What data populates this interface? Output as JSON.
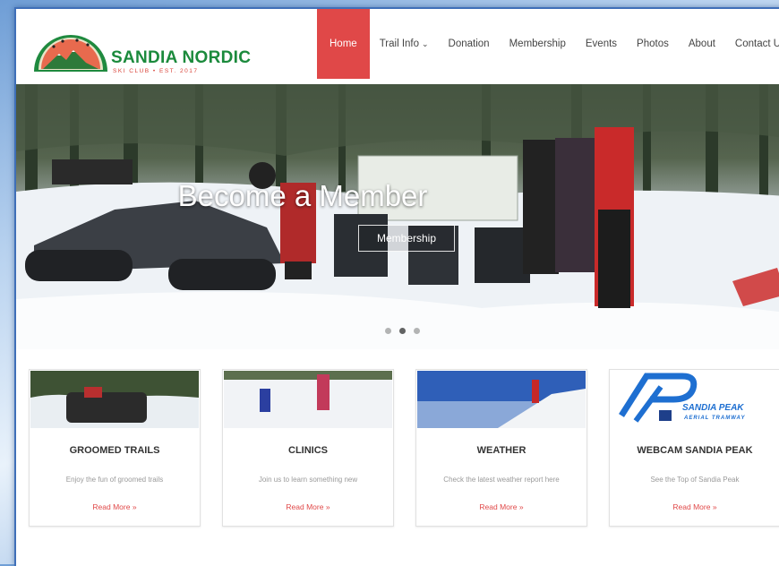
{
  "brand": {
    "name": "SANDIA NORDIC",
    "tagline": "SKI CLUB • EST. 2017"
  },
  "nav": {
    "items": [
      {
        "label": "Home",
        "active": true
      },
      {
        "label": "Trail Info"
      },
      {
        "label": "Donation"
      },
      {
        "label": "Membership"
      },
      {
        "label": "Events"
      },
      {
        "label": "Photos"
      },
      {
        "label": "About"
      },
      {
        "label": "Contact Us"
      }
    ],
    "dropdown_icon": "chevron-down-icon"
  },
  "hero": {
    "title": "Become a Member",
    "button_label": "Membership",
    "slides": 3,
    "active_slide": 1
  },
  "cards": [
    {
      "title": "GROOMED TRAILS",
      "desc": "Enjoy the fun of groomed trails",
      "link": "Read More »"
    },
    {
      "title": "CLINICS",
      "desc": "Join us to learn something new",
      "link": "Read More »"
    },
    {
      "title": "WEATHER",
      "desc": "Check the latest weather report here",
      "link": "Read More »"
    },
    {
      "title": "WEBCAM SANDIA PEAK",
      "desc": "See the Top of Sandia Peak",
      "link": "Read More »"
    }
  ],
  "webcam_logo": {
    "line1": "SANDIA PEAK",
    "line2": "AERIAL TRAMWAY"
  },
  "colors": {
    "accent": "#e04848",
    "brand_green": "#1b8a3c",
    "brand_red": "#d9443a"
  }
}
